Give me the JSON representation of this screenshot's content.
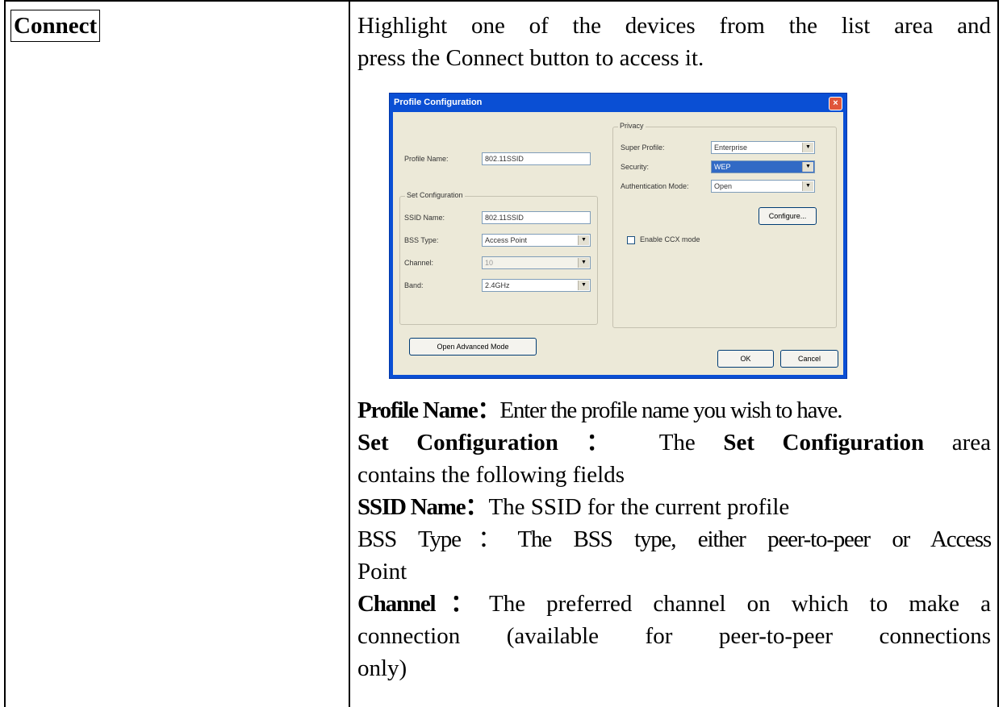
{
  "term": "Connect",
  "intro": {
    "line1": "Highlight one of the devices from the list area and",
    "line2": "press the Connect button to access it."
  },
  "dialog": {
    "title": "Profile Configuration",
    "close_glyph": "×",
    "profile_name_label": "Profile Name:",
    "profile_name_value": "802.11SSID",
    "set_config_group": "Set Configuration",
    "ssid_name_label": "SSID Name:",
    "ssid_name_value": "802.11SSID",
    "bss_type_label": "BSS Type:",
    "bss_type_value": "Access Point",
    "channel_label": "Channel:",
    "channel_value": "10",
    "band_label": "Band:",
    "band_value": "2.4GHz",
    "privacy_group": "Privacy",
    "super_profile_label": "Super Profile:",
    "super_profile_value": "Enterprise",
    "security_label": "Security:",
    "security_value": "WEP",
    "auth_mode_label": "Authentication Mode:",
    "auth_mode_value": "Open",
    "configure_button": "Configure...",
    "ccx_label": "Enable CCX mode",
    "advanced_button": "Open Advanced Mode",
    "ok_button": "OK",
    "cancel_button": "Cancel",
    "dropdown_glyph": "▼"
  },
  "defs": {
    "profile_name_term": "Profile Name",
    "profile_name_text": "Enter the profile name you wish to have.",
    "set_config_term": "Set Configuration",
    "set_config_text1": "The",
    "set_config_bold": "Set Configuration",
    "set_config_text2": "area",
    "set_config_line2": "contains the following fields",
    "ssid_term": "SSID Name",
    "ssid_text": "The SSID for the current profile",
    "bss_text_line1": "BSS Type：The BSS type, either peer-to-peer or Access",
    "bss_text_line2": "Point",
    "channel_term": "Channel",
    "channel_text_line1": "The preferred channel on which to make a",
    "channel_text_line2": "connection (available for peer-to-peer connections",
    "channel_text_line3": "only)",
    "colon": "："
  }
}
